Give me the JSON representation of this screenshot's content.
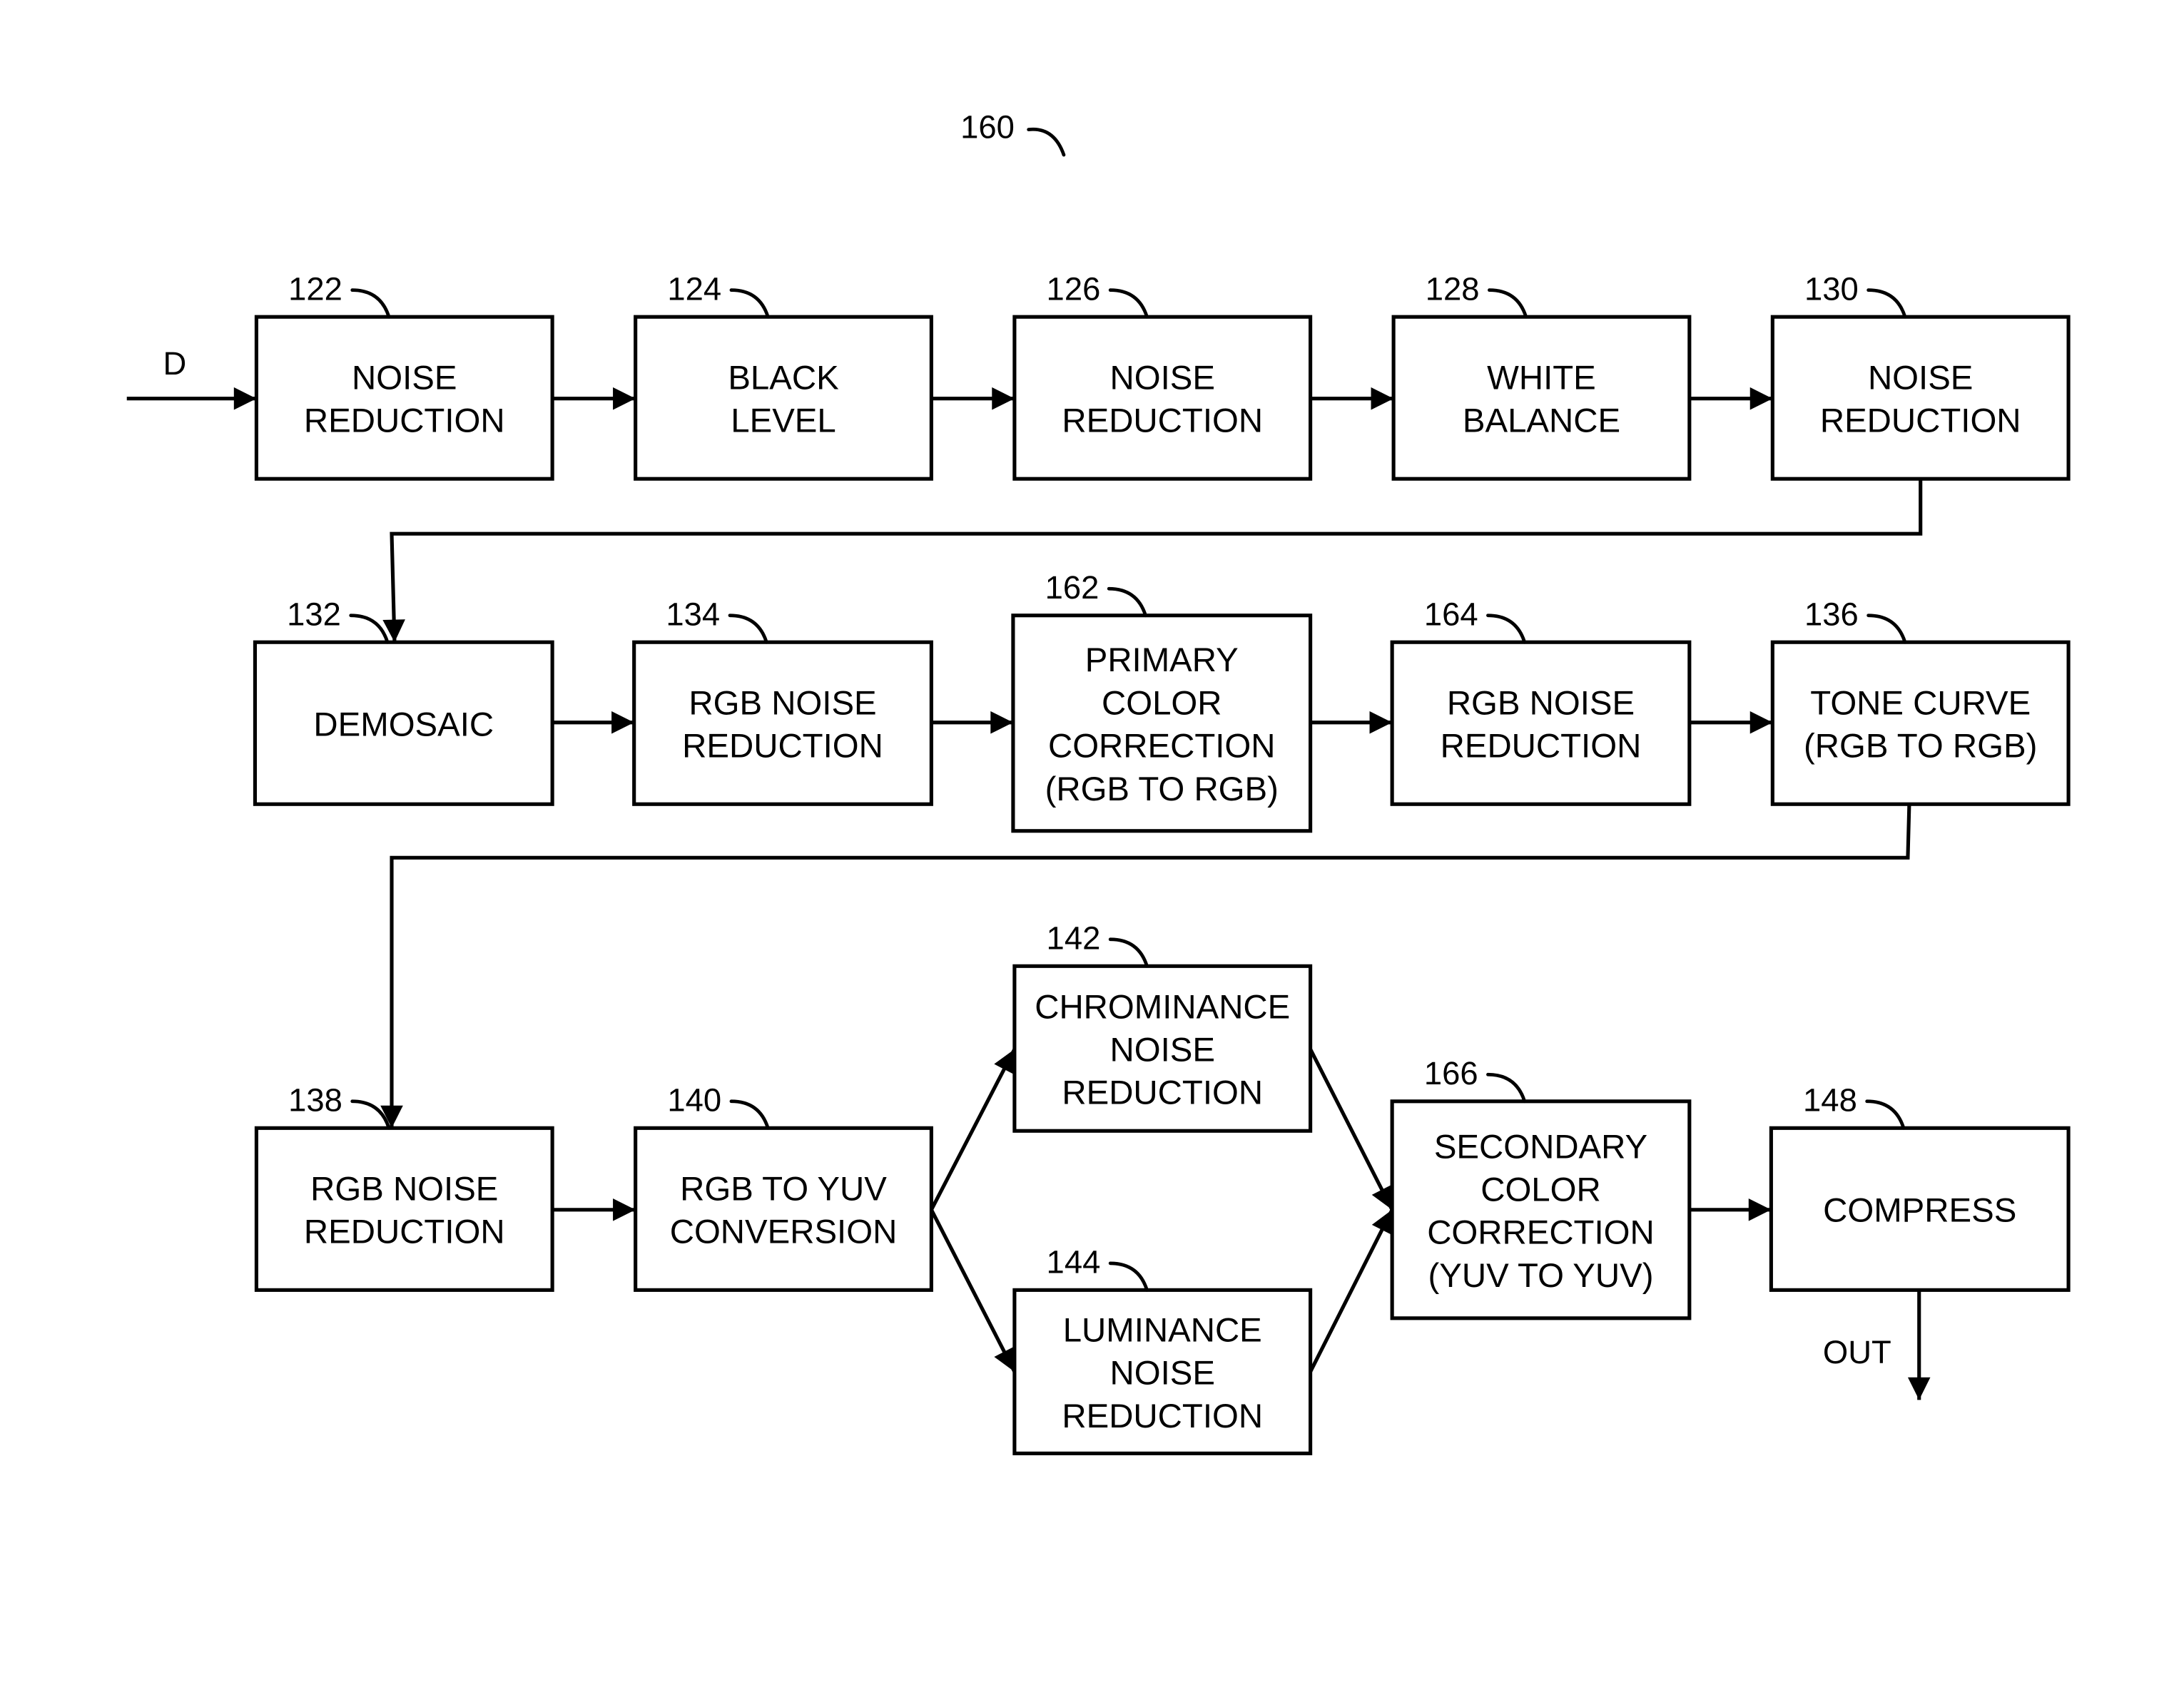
{
  "figure": {
    "ref": "160"
  },
  "input_label": "D",
  "output_label": "OUT",
  "blocks": [
    {
      "id": "b122",
      "ref": "122",
      "lines": [
        "NOISE",
        "REDUCTION"
      ]
    },
    {
      "id": "b124",
      "ref": "124",
      "lines": [
        "BLACK",
        "LEVEL"
      ]
    },
    {
      "id": "b126",
      "ref": "126",
      "lines": [
        "NOISE",
        "REDUCTION"
      ]
    },
    {
      "id": "b128",
      "ref": "128",
      "lines": [
        "WHITE",
        "BALANCE"
      ]
    },
    {
      "id": "b130",
      "ref": "130",
      "lines": [
        "NOISE",
        "REDUCTION"
      ]
    },
    {
      "id": "b132",
      "ref": "132",
      "lines": [
        "DEMOSAIC"
      ]
    },
    {
      "id": "b134",
      "ref": "134",
      "lines": [
        "RGB NOISE",
        "REDUCTION"
      ]
    },
    {
      "id": "b162",
      "ref": "162",
      "lines": [
        "PRIMARY",
        "COLOR",
        "CORRECTION",
        "(RGB TO RGB)"
      ]
    },
    {
      "id": "b164",
      "ref": "164",
      "lines": [
        "RGB NOISE",
        "REDUCTION"
      ]
    },
    {
      "id": "b136",
      "ref": "136",
      "lines": [
        "TONE CURVE",
        "(RGB TO RGB)"
      ]
    },
    {
      "id": "b138",
      "ref": "138",
      "lines": [
        "RGB NOISE",
        "REDUCTION"
      ]
    },
    {
      "id": "b140",
      "ref": "140",
      "lines": [
        "RGB TO YUV",
        "CONVERSION"
      ]
    },
    {
      "id": "b142",
      "ref": "142",
      "lines": [
        "CHROMINANCE",
        "NOISE",
        "REDUCTION"
      ]
    },
    {
      "id": "b144",
      "ref": "144",
      "lines": [
        "LUMINANCE",
        "NOISE",
        "REDUCTION"
      ]
    },
    {
      "id": "b166",
      "ref": "166",
      "lines": [
        "SECONDARY",
        "COLOR",
        "CORRECTION",
        "(YUV TO YUV)"
      ]
    },
    {
      "id": "b148",
      "ref": "148",
      "lines": [
        "COMPRESS"
      ]
    }
  ],
  "connections": [
    [
      "input",
      "b122"
    ],
    [
      "b122",
      "b124"
    ],
    [
      "b124",
      "b126"
    ],
    [
      "b126",
      "b128"
    ],
    [
      "b128",
      "b130"
    ],
    [
      "b130",
      "b132"
    ],
    [
      "b132",
      "b134"
    ],
    [
      "b134",
      "b162"
    ],
    [
      "b162",
      "b164"
    ],
    [
      "b164",
      "b136"
    ],
    [
      "b136",
      "b138"
    ],
    [
      "b138",
      "b140"
    ],
    [
      "b140",
      "b142"
    ],
    [
      "b140",
      "b144"
    ],
    [
      "b142",
      "b166"
    ],
    [
      "b144",
      "b166"
    ],
    [
      "b166",
      "b148"
    ],
    [
      "b148",
      "output"
    ]
  ]
}
